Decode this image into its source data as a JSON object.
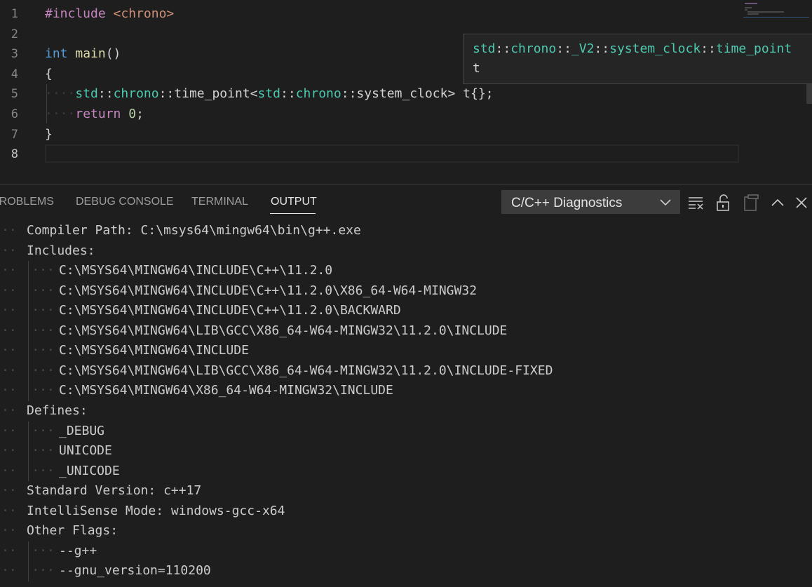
{
  "editor": {
    "lines": [
      {
        "num": "1",
        "tokens": [
          {
            "t": "#include ",
            "c": "ctl"
          },
          {
            "t": "<chrono>",
            "c": "str"
          }
        ]
      },
      {
        "num": "2",
        "tokens": []
      },
      {
        "num": "3",
        "tokens": [
          {
            "t": "int",
            "c": "kw"
          },
          {
            "t": " ",
            "c": ""
          },
          {
            "t": "main",
            "c": "fn"
          },
          {
            "t": "()",
            "c": ""
          }
        ]
      },
      {
        "num": "4",
        "tokens": [
          {
            "t": "{",
            "c": ""
          }
        ]
      },
      {
        "num": "5",
        "tokens": [
          {
            "t": "····",
            "c": "ws"
          },
          {
            "t": "std",
            "c": "ns"
          },
          {
            "t": "::",
            "c": ""
          },
          {
            "t": "chrono",
            "c": "ns"
          },
          {
            "t": "::",
            "c": ""
          },
          {
            "t": "time_point",
            "c": ""
          },
          {
            "t": "<",
            "c": ""
          },
          {
            "t": "std",
            "c": "ns"
          },
          {
            "t": "::",
            "c": ""
          },
          {
            "t": "chrono",
            "c": "ns"
          },
          {
            "t": "::",
            "c": ""
          },
          {
            "t": "system_clock",
            "c": ""
          },
          {
            "t": "> ",
            "c": ""
          },
          {
            "t": "t",
            "c": ""
          },
          {
            "t": "{};",
            "c": ""
          }
        ]
      },
      {
        "num": "6",
        "tokens": [
          {
            "t": "····",
            "c": "ws"
          },
          {
            "t": "return",
            "c": "ctl"
          },
          {
            "t": " ",
            "c": ""
          },
          {
            "t": "0",
            "c": "num"
          },
          {
            "t": ";",
            "c": ""
          }
        ]
      },
      {
        "num": "7",
        "tokens": [
          {
            "t": "}",
            "c": ""
          }
        ]
      },
      {
        "num": "8",
        "tokens": []
      }
    ],
    "active_line": "8"
  },
  "tooltip": {
    "line1": [
      {
        "t": "std",
        "c": "ns"
      },
      {
        "t": "::",
        "c": ""
      },
      {
        "t": "chrono",
        "c": "ns"
      },
      {
        "t": "::",
        "c": ""
      },
      {
        "t": "_V2",
        "c": "ns"
      },
      {
        "t": "::",
        "c": ""
      },
      {
        "t": "system_clock",
        "c": "ns"
      },
      {
        "t": "::",
        "c": ""
      },
      {
        "t": "time_point",
        "c": "ns"
      }
    ],
    "line2": "t"
  },
  "panel": {
    "tabs": [
      {
        "id": "problems",
        "label": "PROBLEMS"
      },
      {
        "id": "debug-console",
        "label": "DEBUG CONSOLE"
      },
      {
        "id": "terminal",
        "label": "TERMINAL"
      },
      {
        "id": "output",
        "label": "OUTPUT"
      }
    ],
    "active_tab": "output",
    "channel": "C/C++ Diagnostics",
    "icons": [
      "clear-output-icon",
      "lock-scroll-icon",
      "copy-icon",
      "maximize-panel-icon",
      "close-icon"
    ]
  },
  "output": {
    "lines": [
      {
        "indent": 1,
        "text": "Compiler Path: C:\\msys64\\mingw64\\bin\\g++.exe"
      },
      {
        "indent": 1,
        "text": "Includes:"
      },
      {
        "indent": 2,
        "text": "C:\\MSYS64\\MINGW64\\INCLUDE\\C++\\11.2.0"
      },
      {
        "indent": 2,
        "text": "C:\\MSYS64\\MINGW64\\INCLUDE\\C++\\11.2.0\\X86_64-W64-MINGW32"
      },
      {
        "indent": 2,
        "text": "C:\\MSYS64\\MINGW64\\INCLUDE\\C++\\11.2.0\\BACKWARD"
      },
      {
        "indent": 2,
        "text": "C:\\MSYS64\\MINGW64\\LIB\\GCC\\X86_64-W64-MINGW32\\11.2.0\\INCLUDE"
      },
      {
        "indent": 2,
        "text": "C:\\MSYS64\\MINGW64\\INCLUDE"
      },
      {
        "indent": 2,
        "text": "C:\\MSYS64\\MINGW64\\LIB\\GCC\\X86_64-W64-MINGW32\\11.2.0\\INCLUDE-FIXED"
      },
      {
        "indent": 2,
        "text": "C:\\MSYS64\\MINGW64\\X86_64-W64-MINGW32\\INCLUDE"
      },
      {
        "indent": 1,
        "text": "Defines:"
      },
      {
        "indent": 2,
        "text": "_DEBUG"
      },
      {
        "indent": 2,
        "text": "UNICODE"
      },
      {
        "indent": 2,
        "text": "_UNICODE"
      },
      {
        "indent": 1,
        "text": "Standard Version: c++17"
      },
      {
        "indent": 1,
        "text": "IntelliSense Mode: windows-gcc-x64"
      },
      {
        "indent": 1,
        "text": "Other Flags:"
      },
      {
        "indent": 2,
        "text": "--g++"
      },
      {
        "indent": 2,
        "text": "--gnu_version=110200"
      }
    ]
  }
}
